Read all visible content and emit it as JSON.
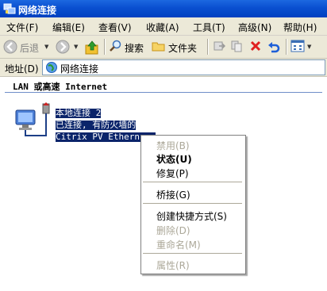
{
  "window": {
    "title": "网络连接"
  },
  "menubar": {
    "items": [
      "文件(F)",
      "编辑(E)",
      "查看(V)",
      "收藏(A)",
      "工具(T)",
      "高级(N)",
      "帮助(H)"
    ]
  },
  "toolbar": {
    "back_label": "后退",
    "search_label": "搜索",
    "folders_label": "文件夹"
  },
  "addressbar": {
    "label": "地址(D)",
    "value": "网络连接"
  },
  "content": {
    "group_header": "LAN 或高速 Internet",
    "connection": {
      "name": "本地连接 2",
      "status": "已连接, 有防火墙的",
      "device": "Citrix PV Ethern..."
    }
  },
  "context_menu": {
    "disable": "禁用(B)",
    "status": "状态(U)",
    "repair": "修复(P)",
    "bridge": "桥接(G)",
    "create_shortcut": "创建快捷方式(S)",
    "delete": "删除(D)",
    "rename": "重命名(M)",
    "properties": "属性(R)"
  },
  "colors": {
    "titlebar": "#0a4fd0",
    "chrome": "#ece9d8",
    "selection": "#0a246a",
    "disabled_text": "#aca899"
  }
}
